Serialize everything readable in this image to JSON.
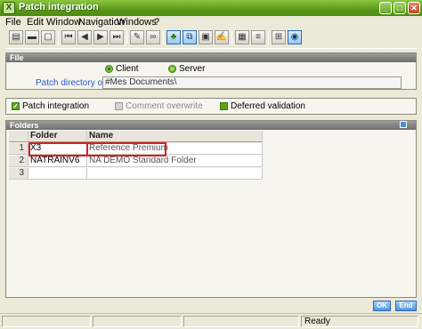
{
  "window": {
    "title": "Patch integration",
    "app_icon": "X"
  },
  "menu": [
    "File",
    "Edit",
    "Window",
    "Navigation",
    "Windows",
    "?"
  ],
  "toolbar_icons": [
    "new-icon",
    "print-icon",
    "preview-icon",
    "first-icon",
    "previous-icon",
    "next-icon",
    "last-icon",
    "attach-icon",
    "link-icon",
    "graph-icon",
    "copy-icon",
    "paste-icon",
    "wizard-icon",
    "table-icon",
    "text-icon",
    "diagram-icon",
    "help-icon"
  ],
  "file_section": {
    "title": "File",
    "client_label": "Client",
    "server_label": "Server",
    "path_label": "Patch directory or file",
    "path_value": "#Mes Documents\\"
  },
  "options": {
    "patch_integration": "Patch integration",
    "comment_overwrite": "Comment overwrite",
    "deferred_validation": "Deferred validation"
  },
  "folders_section": {
    "title": "Folders",
    "columns": [
      "Folder",
      "Name"
    ],
    "rows": [
      {
        "num": "1",
        "folder": "X3",
        "name": "Reference Premium"
      },
      {
        "num": "2",
        "folder": "NATRAINV6",
        "name": "NA DEMO Standard Folder"
      },
      {
        "num": "3",
        "folder": "",
        "name": ""
      }
    ]
  },
  "buttons": {
    "ok": "OK",
    "end": "End"
  },
  "status": {
    "text": "Ready"
  },
  "colors": {
    "highlight": "#d42222",
    "title_green": "#5a9a1a",
    "link": "#2a57d6"
  }
}
